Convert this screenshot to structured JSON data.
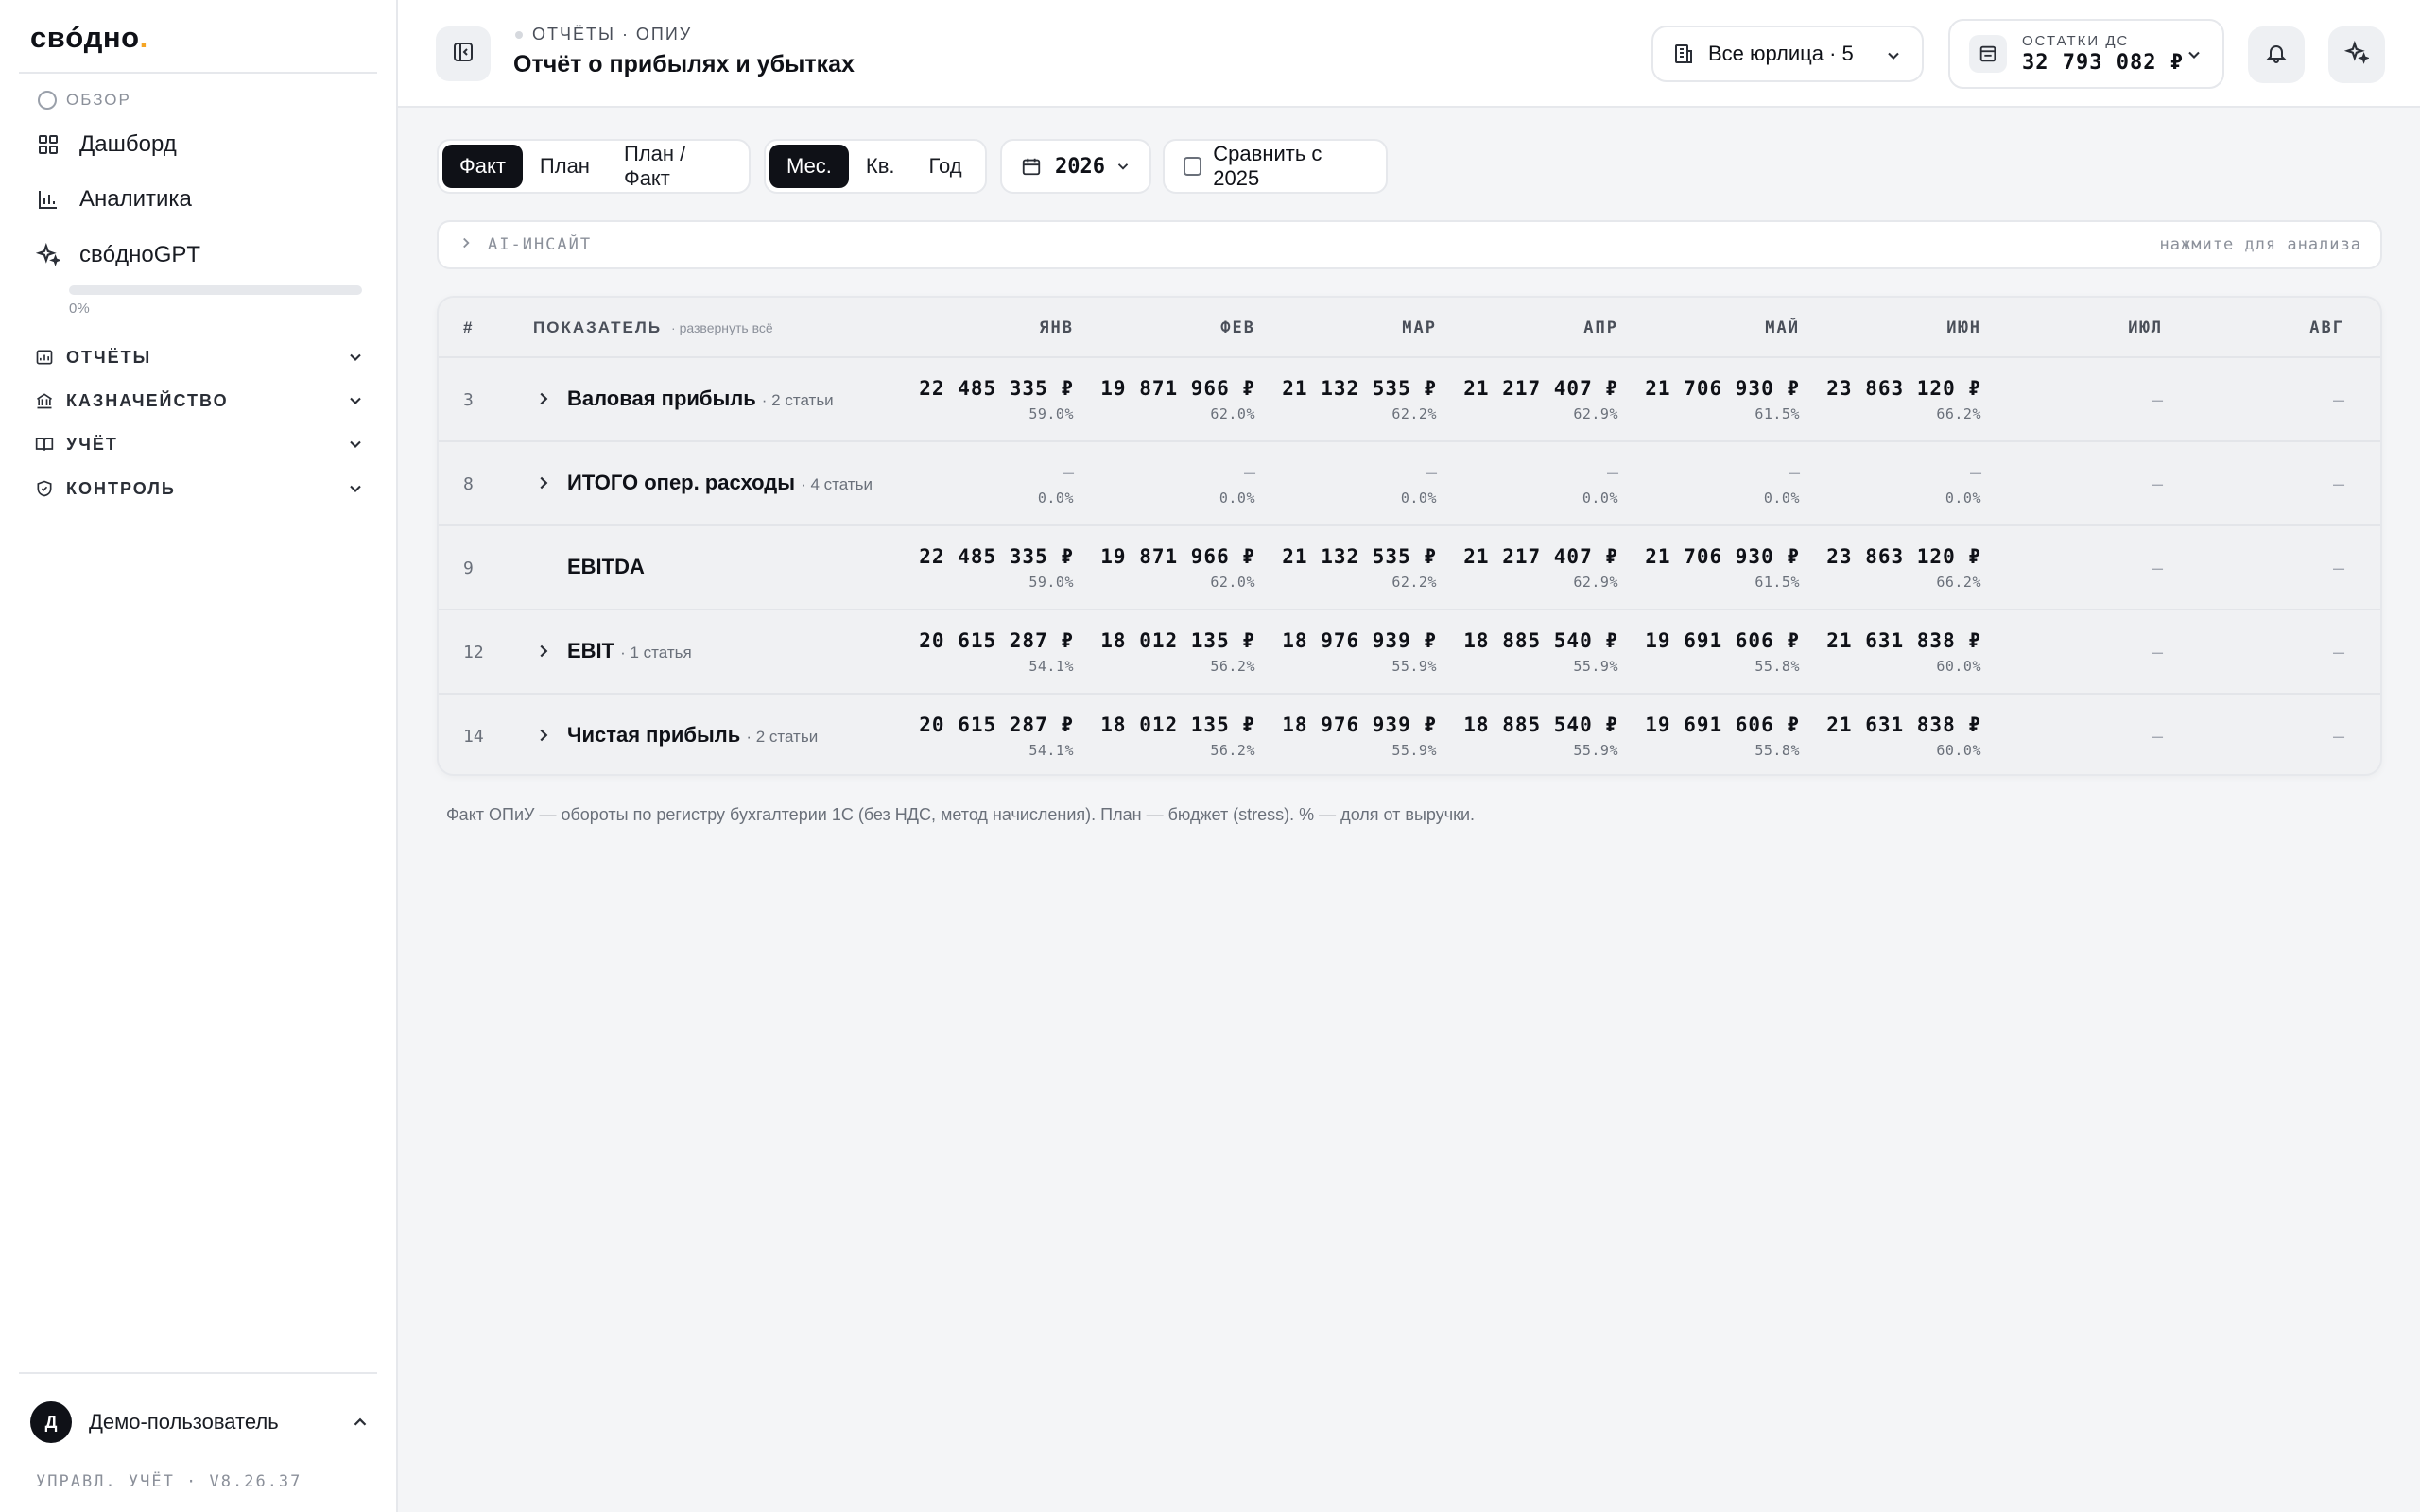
{
  "app": {
    "logo_text": "свóдно",
    "logo_dot": "."
  },
  "sidebar": {
    "section_overview": "ОБЗОР",
    "items": [
      {
        "label": "Дашборд",
        "icon": "grid-icon"
      },
      {
        "label": "Аналитика",
        "icon": "bar-chart-icon"
      },
      {
        "label": "свóдноGPT",
        "icon": "sparkle-icon"
      }
    ],
    "progress_percent": 0,
    "progress_label": "0%",
    "groups": [
      {
        "label": "ОТЧЁТЫ",
        "icon": "report-icon"
      },
      {
        "label": "КАЗНАЧЕЙСТВО",
        "icon": "bank-icon"
      },
      {
        "label": "УЧЁТ",
        "icon": "book-icon"
      },
      {
        "label": "КОНТРОЛЬ",
        "icon": "shield-icon"
      }
    ],
    "user": {
      "initial": "Д",
      "name": "Демо-пользователь"
    },
    "version": "УПРАВЛ. УЧЁТ · V8.26.37"
  },
  "header": {
    "breadcrumb": "ОТЧЁТЫ · ОПИУ",
    "title": "Отчёт о прибылях и убытках",
    "entity_selector": "Все юрлица · 5",
    "balance_label": "ОСТАТКИ ДС",
    "balance_value": "32 793 082 ₽"
  },
  "toolbar": {
    "mode_options": [
      "Факт",
      "План",
      "План / Факт"
    ],
    "mode_selected": "Факт",
    "period_options": [
      "Мес.",
      "Кв.",
      "Год"
    ],
    "period_selected": "Мес.",
    "year": "2026",
    "compare_label": "Сравнить с 2025",
    "compare_checked": false
  },
  "ai_insight": {
    "label": "AI-ИНСАЙТ",
    "hint": "нажмите для анализа"
  },
  "table": {
    "col_num": "#",
    "col_indicator": "ПОКАЗАТЕЛЬ",
    "expand_all": "· развернуть всё",
    "months": [
      "ЯНВ",
      "ФЕВ",
      "МАР",
      "АПР",
      "МАЙ",
      "ИЮН",
      "ИЮЛ",
      "АВГ"
    ],
    "rows": [
      {
        "num": "3",
        "label": "Валовая прибыль",
        "sub": "· 2 статьи",
        "expandable": true,
        "values": [
          "22 485 335 ₽",
          "19 871 966 ₽",
          "21 132 535 ₽",
          "21 217 407 ₽",
          "21 706 930 ₽",
          "23 863 120 ₽",
          "—",
          "—"
        ],
        "percents": [
          "59.0%",
          "62.0%",
          "62.2%",
          "62.9%",
          "61.5%",
          "66.2%",
          "",
          ""
        ]
      },
      {
        "num": "8",
        "label": "ИТОГО опер. расходы",
        "sub": "· 4 статьи",
        "expandable": true,
        "values": [
          "—",
          "—",
          "—",
          "—",
          "—",
          "—",
          "—",
          "—"
        ],
        "percents": [
          "0.0%",
          "0.0%",
          "0.0%",
          "0.0%",
          "0.0%",
          "0.0%",
          "",
          ""
        ]
      },
      {
        "num": "9",
        "label": "EBITDA",
        "sub": "",
        "expandable": false,
        "values": [
          "22 485 335 ₽",
          "19 871 966 ₽",
          "21 132 535 ₽",
          "21 217 407 ₽",
          "21 706 930 ₽",
          "23 863 120 ₽",
          "—",
          "—"
        ],
        "percents": [
          "59.0%",
          "62.0%",
          "62.2%",
          "62.9%",
          "61.5%",
          "66.2%",
          "",
          ""
        ]
      },
      {
        "num": "12",
        "label": "EBIT",
        "sub": "· 1 статья",
        "expandable": true,
        "values": [
          "20 615 287 ₽",
          "18 012 135 ₽",
          "18 976 939 ₽",
          "18 885 540 ₽",
          "19 691 606 ₽",
          "21 631 838 ₽",
          "—",
          "—"
        ],
        "percents": [
          "54.1%",
          "56.2%",
          "55.9%",
          "55.9%",
          "55.8%",
          "60.0%",
          "",
          ""
        ]
      },
      {
        "num": "14",
        "label": "Чистая прибыль",
        "sub": "· 2 статьи",
        "expandable": true,
        "values": [
          "20 615 287 ₽",
          "18 012 135 ₽",
          "18 976 939 ₽",
          "18 885 540 ₽",
          "19 691 606 ₽",
          "21 631 838 ₽",
          "—",
          "—"
        ],
        "percents": [
          "54.1%",
          "56.2%",
          "55.9%",
          "55.9%",
          "55.8%",
          "60.0%",
          "",
          ""
        ]
      }
    ]
  },
  "footnote": "Факт ОПиУ — обороты по регистру бухгалтерии 1С (без НДС, метод начисления). План — бюджет (stress). % — доля от выручки."
}
